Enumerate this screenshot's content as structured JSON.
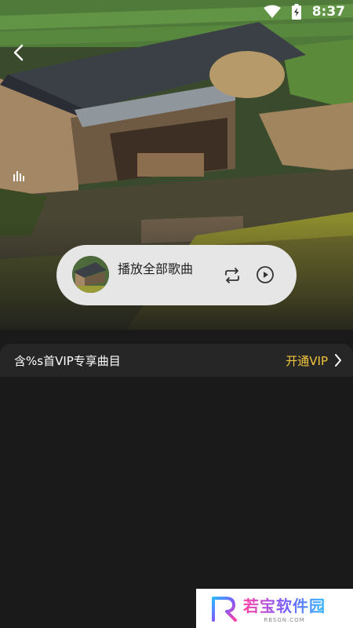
{
  "status_bar": {
    "time": "8:37"
  },
  "player": {
    "title": "播放全部歌曲"
  },
  "vip_banner": {
    "info_text": "含%s首VIP专享曲目",
    "action_label": "开通VIP",
    "accent_color": "#f5c73c"
  },
  "watermark": {
    "title": "若宝软件园",
    "subtitle": "RBSGN.COM"
  },
  "icons": {
    "back": "chevron-left-icon",
    "bars": "equalizer-icon",
    "repeat": "repeat-icon",
    "play": "play-circle-icon",
    "chevron": "chevron-right-icon",
    "wifi": "wifi-icon",
    "battery": "battery-charging-icon"
  }
}
